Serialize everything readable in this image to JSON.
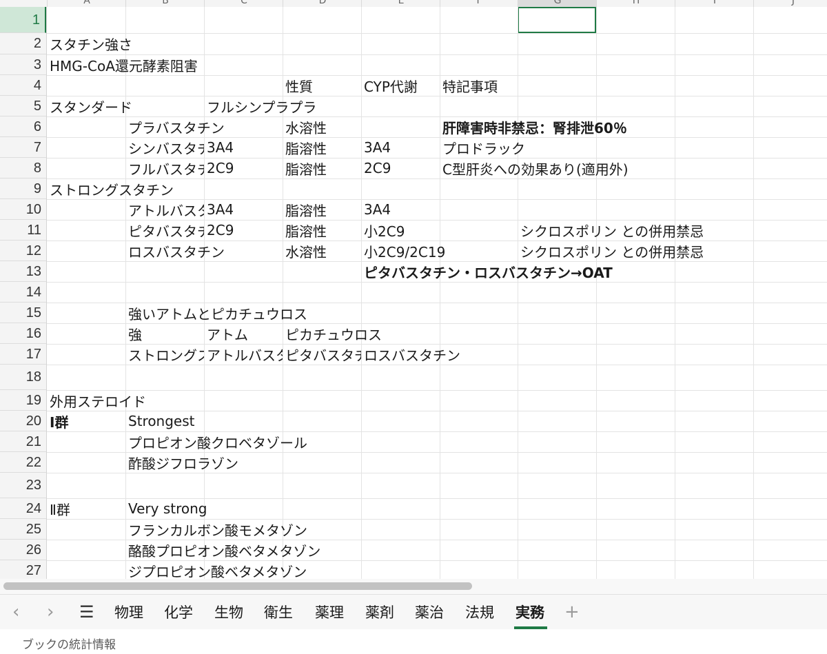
{
  "columns": [
    "A",
    "B",
    "C",
    "D",
    "E",
    "F",
    "G",
    "H",
    "I",
    "J"
  ],
  "active_column": "G",
  "active_row": 1,
  "rows": [
    1,
    2,
    3,
    4,
    5,
    6,
    7,
    8,
    9,
    10,
    11,
    12,
    13,
    14,
    15,
    16,
    17,
    18,
    19,
    20,
    21,
    22,
    23,
    24,
    25,
    26,
    27
  ],
  "cells": [
    {
      "row": 2,
      "col": "A",
      "text": "スタチン強さ"
    },
    {
      "row": 3,
      "col": "A",
      "text": "HMG-CoA還元酵素阻害"
    },
    {
      "row": 4,
      "col": "D",
      "text": "性質"
    },
    {
      "row": 4,
      "col": "E",
      "text": "CYP代謝"
    },
    {
      "row": 4,
      "col": "F",
      "text": "特記事項"
    },
    {
      "row": 5,
      "col": "A",
      "text": "スタンダード"
    },
    {
      "row": 5,
      "col": "C",
      "text": "フルシンプラプラ"
    },
    {
      "row": 6,
      "col": "B",
      "text": "プラバスタチン"
    },
    {
      "row": 6,
      "col": "D",
      "text": "水溶性"
    },
    {
      "row": 6,
      "col": "F",
      "text": "肝障害時非禁忌：腎排泄60％",
      "bold": true
    },
    {
      "row": 7,
      "col": "B",
      "text": "シンバスタチン",
      "clip": true
    },
    {
      "row": 7,
      "col": "C",
      "text": "3A4"
    },
    {
      "row": 7,
      "col": "D",
      "text": "脂溶性"
    },
    {
      "row": 7,
      "col": "E",
      "text": "3A4"
    },
    {
      "row": 7,
      "col": "F",
      "text": "プロドラック"
    },
    {
      "row": 8,
      "col": "B",
      "text": "フルバスタチン",
      "clip": true
    },
    {
      "row": 8,
      "col": "C",
      "text": "2C9"
    },
    {
      "row": 8,
      "col": "D",
      "text": "脂溶性"
    },
    {
      "row": 8,
      "col": "E",
      "text": "2C9"
    },
    {
      "row": 8,
      "col": "F",
      "text": "C型肝炎への効果あり(適用外)"
    },
    {
      "row": 9,
      "col": "A",
      "text": "ストロングスタチン"
    },
    {
      "row": 10,
      "col": "B",
      "text": "アトルバスタチン",
      "clip": true
    },
    {
      "row": 10,
      "col": "C",
      "text": "3A4"
    },
    {
      "row": 10,
      "col": "D",
      "text": "脂溶性"
    },
    {
      "row": 10,
      "col": "E",
      "text": "3A4"
    },
    {
      "row": 11,
      "col": "B",
      "text": "ピタバスタチン",
      "clip": true
    },
    {
      "row": 11,
      "col": "C",
      "text": "2C9"
    },
    {
      "row": 11,
      "col": "D",
      "text": "脂溶性"
    },
    {
      "row": 11,
      "col": "E",
      "text": "小2C9"
    },
    {
      "row": 11,
      "col": "G",
      "text": "シクロスポリン との併用禁忌"
    },
    {
      "row": 12,
      "col": "B",
      "text": "ロスバスタチン"
    },
    {
      "row": 12,
      "col": "D",
      "text": "水溶性"
    },
    {
      "row": 12,
      "col": "E",
      "text": "小2C9/2C19"
    },
    {
      "row": 12,
      "col": "G",
      "text": "シクロスポリン との併用禁忌"
    },
    {
      "row": 13,
      "col": "E",
      "text": "ピタバスタチン・ロスバスタチン→OAT",
      "bold": true
    },
    {
      "row": 15,
      "col": "B",
      "text": "強いアトムとピカチュウロス"
    },
    {
      "row": 16,
      "col": "B",
      "text": "強"
    },
    {
      "row": 16,
      "col": "C",
      "text": "アトム"
    },
    {
      "row": 16,
      "col": "D",
      "text": "ピカチュウロス"
    },
    {
      "row": 17,
      "col": "B",
      "text": "ストロングスタチン",
      "clip": true
    },
    {
      "row": 17,
      "col": "C",
      "text": "アトルバスタチン",
      "clip": true
    },
    {
      "row": 17,
      "col": "D",
      "text": "ピタバスタチン",
      "clip": true
    },
    {
      "row": 17,
      "col": "E",
      "text": "ロスバスタチン"
    },
    {
      "row": 19,
      "col": "A",
      "text": "外用ステロイド"
    },
    {
      "row": 20,
      "col": "A",
      "text": " Ⅰ群",
      "bold": true
    },
    {
      "row": 20,
      "col": "B",
      "text": "Strongest"
    },
    {
      "row": 21,
      "col": "B",
      "text": "プロピオン酸クロベタゾール"
    },
    {
      "row": 22,
      "col": "B",
      "text": "酢酸ジフロラゾン"
    },
    {
      "row": 24,
      "col": "A",
      "text": " Ⅱ群"
    },
    {
      "row": 24,
      "col": "B",
      "text": "Very strong"
    },
    {
      "row": 25,
      "col": "B",
      "text": "フランカルボン酸モメタゾン"
    },
    {
      "row": 26,
      "col": "B",
      "text": "酪酸プロピオン酸ベタメタゾン"
    },
    {
      "row": 27,
      "col": "B",
      "text": "ジプロピオン酸ベタメタゾン"
    }
  ],
  "tabbar": {
    "prev": "‹",
    "next": "›",
    "menu": "☰",
    "add": "+",
    "tabs": [
      "物理",
      "化学",
      "生物",
      "衛生",
      "薬理",
      "薬剤",
      "薬治",
      "法規",
      "実務"
    ],
    "active_tab": "実務"
  },
  "status": {
    "text": "ブックの統計情報"
  },
  "colors": {
    "accent": "#1f7a45"
  }
}
